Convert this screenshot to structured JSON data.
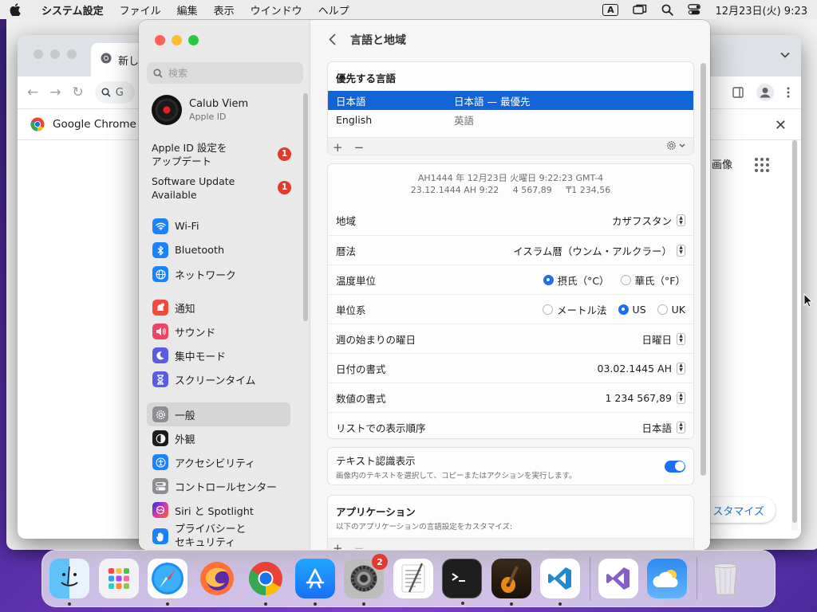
{
  "menubar": {
    "app_name": "システム設定",
    "items": [
      "ファイル",
      "編集",
      "表示",
      "ウインドウ",
      "ヘルプ"
    ],
    "input_indicator": "A",
    "datetime": "12月23日(火)  9:23"
  },
  "chrome": {
    "tab_title": "新し",
    "omnibox_text": "G",
    "bookmark_label": "Google Chrome",
    "images_link": "画像",
    "customize_label": "スタマイズ"
  },
  "settings": {
    "search_placeholder": "検索",
    "account": {
      "name": "Calub Viem",
      "sub": "Apple ID"
    },
    "notices": [
      {
        "label": "Apple ID 設定を\nアップデート",
        "badge": "1"
      },
      {
        "label": "Software Update\nAvailable",
        "badge": "1"
      }
    ],
    "nav_groups": [
      [
        {
          "label": "Wi-Fi",
          "icon": "wifi-icon",
          "color": "#1a82fb"
        },
        {
          "label": "Bluetooth",
          "icon": "bluetooth-icon",
          "color": "#1a82fb"
        },
        {
          "label": "ネットワーク",
          "icon": "globe-icon",
          "color": "#1a82fb"
        }
      ],
      [
        {
          "label": "通知",
          "icon": "bell-icon",
          "color": "#ef4b3d"
        },
        {
          "label": "サウンド",
          "icon": "speaker-icon",
          "color": "#ef4267"
        },
        {
          "label": "集中モード",
          "icon": "moon-icon",
          "color": "#5c5ce0"
        },
        {
          "label": "スクリーンタイム",
          "icon": "hourglass-icon",
          "color": "#5c5ce0"
        }
      ],
      [
        {
          "label": "一般",
          "icon": "gear-icon",
          "color": "#8e8e93",
          "selected": true
        },
        {
          "label": "外観",
          "icon": "appearance-icon",
          "color": "#1c1c1e"
        },
        {
          "label": "アクセシビリティ",
          "icon": "accessibility-icon",
          "color": "#1a82fb"
        },
        {
          "label": "コントロールセンター",
          "icon": "control-center-icon",
          "color": "#8e8e93"
        },
        {
          "label": "Siri と Spotlight",
          "icon": "siri-icon",
          "color": "#b04ad8"
        },
        {
          "label": "プライバシーと\nセキュリティ",
          "icon": "hand-icon",
          "color": "#1a82fb"
        }
      ]
    ],
    "page_title": "言語と地域",
    "preferred_languages": {
      "title": "優先する言語",
      "rows": [
        {
          "name": "日本語",
          "detail": "日本語 — 最優先",
          "selected": true
        },
        {
          "name": "English",
          "detail": "英語",
          "selected": false
        }
      ]
    },
    "preview": {
      "line1": "AH1444 年 12月23日 火曜日 9:22:23 GMT-4",
      "line2": "23.12.1444 AH 9:22     4 567,89     ₸1 234,56"
    },
    "rows": {
      "region": {
        "label": "地域",
        "value": "カザフスタン"
      },
      "calendar": {
        "label": "暦法",
        "value": "イスラム暦（ウンム・アルクラー）"
      },
      "temperature": {
        "label": "温度単位",
        "options": [
          "摂氏（°C）",
          "華氏（°F）"
        ],
        "selected": 0
      },
      "measurement": {
        "label": "単位系",
        "options": [
          "メートル法",
          "US",
          "UK"
        ],
        "selected": 1
      },
      "first_day": {
        "label": "週の始まりの曜日",
        "value": "日曜日"
      },
      "date_format": {
        "label": "日付の書式",
        "value": "03.02.1445 AH"
      },
      "number_format": {
        "label": "数値の書式",
        "value": "1 234 567,89"
      },
      "list_sort": {
        "label": "リストでの表示順序",
        "value": "日本語"
      }
    },
    "live_text": {
      "label": "テキスト認識表示",
      "desc": "画像内のテキストを選択して、コピーまたはアクションを実行します。",
      "enabled": true
    },
    "applications": {
      "title": "アプリケーション",
      "desc": "以下のアプリケーションの言語設定をカスタマイズ:"
    }
  },
  "dock": {
    "items": [
      {
        "name": "finder-icon",
        "running": true
      },
      {
        "name": "launchpad-icon",
        "running": false
      },
      {
        "name": "safari-icon",
        "running": true
      },
      {
        "name": "firefox-icon",
        "running": false
      },
      {
        "name": "chrome-icon",
        "running": true
      },
      {
        "name": "app-store-icon",
        "running": true
      },
      {
        "name": "system-settings-icon",
        "running": true,
        "badge": "2"
      },
      {
        "name": "textedit-icon",
        "running": false
      },
      {
        "name": "terminal-icon",
        "running": true
      },
      {
        "name": "garageband-icon",
        "running": true
      },
      {
        "name": "vscode-icon",
        "running": true
      },
      {
        "name": "visual-studio-icon",
        "running": false
      },
      {
        "name": "weather-icon",
        "running": false
      },
      {
        "name": "trash-icon",
        "running": false
      }
    ]
  }
}
